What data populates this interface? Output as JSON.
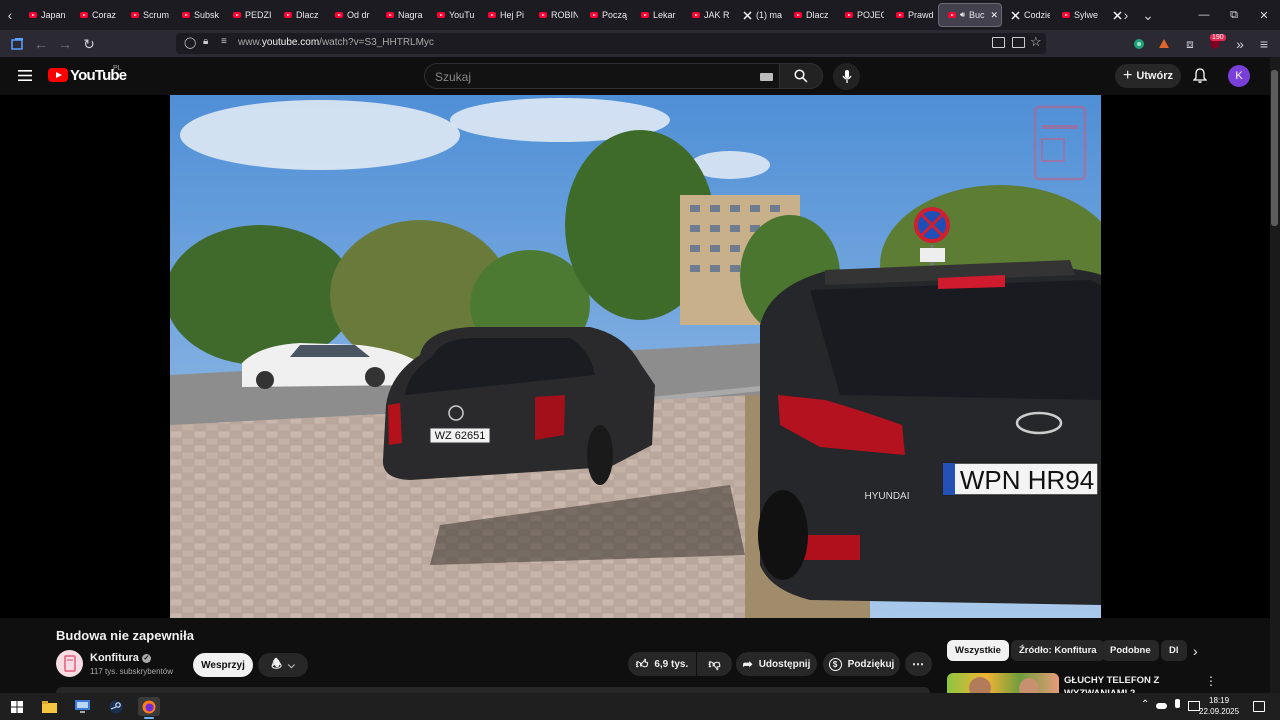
{
  "browser": {
    "tabs": [
      {
        "label": "Japan",
        "favicon": "youtube-icon"
      },
      {
        "label": "Coraz",
        "favicon": "youtube-icon"
      },
      {
        "label": "Scrum",
        "favicon": "youtube-icon"
      },
      {
        "label": "Subsk",
        "favicon": "youtube-icon"
      },
      {
        "label": "PEDZI",
        "favicon": "youtube-icon"
      },
      {
        "label": "Dlacz",
        "favicon": "youtube-icon"
      },
      {
        "label": "Od dr",
        "favicon": "youtube-icon"
      },
      {
        "label": "Nagra",
        "favicon": "youtube-icon"
      },
      {
        "label": "YouTu",
        "favicon": "youtube-icon"
      },
      {
        "label": "Hej Pi",
        "favicon": "youtube-icon"
      },
      {
        "label": "ROBIN",
        "favicon": "youtube-icon"
      },
      {
        "label": "Począ",
        "favicon": "youtube-icon"
      },
      {
        "label": "Lekar",
        "favicon": "youtube-icon"
      },
      {
        "label": "JAK R",
        "favicon": "youtube-icon"
      },
      {
        "label": "(1) ma",
        "favicon": "x-icon"
      },
      {
        "label": "Dlacz",
        "favicon": "youtube-icon"
      },
      {
        "label": "POJEC",
        "favicon": "youtube-icon"
      },
      {
        "label": "Prawd",
        "favicon": "youtube-icon"
      }
    ],
    "active_tab": {
      "label": "Buc",
      "favicon": "youtube-icon"
    },
    "after_tabs": [
      {
        "label": "Codzie",
        "favicon": "x-icon"
      },
      {
        "label": "Sylwe",
        "favicon": "youtube-icon"
      }
    ],
    "url_prefix": "www.",
    "url_domain": "youtube.com",
    "url_path": "/watch?v=S3_HHTRLMyc",
    "extension_badge": "190"
  },
  "youtube": {
    "logo_text": "YouTube",
    "country_code": "PL",
    "search_placeholder": "Szukaj",
    "create_label": "Utwórz",
    "avatar_letter": "K"
  },
  "video": {
    "title": "Budowa nie zapewniła",
    "channel_name": "Konfitura",
    "channel_subs": "117 tys. subskrybentów",
    "support_label": "Wesprzyj",
    "likes": "6,9 tys.",
    "share_label": "Udostępnij",
    "thanks_label": "Podziękuj",
    "plate_front": "WZ 62651",
    "plate_right": "WPN HR94",
    "car_brand": "HYUNDAI"
  },
  "chips": [
    "Wszystkie",
    "Źródło: Konfitura",
    "Podobne",
    "Dl"
  ],
  "recommendation": {
    "title_line1": "GŁUCHY TELEFON Z",
    "title_line2": "WYZWANIAMI 2"
  },
  "taskbar": {
    "time": "18:19",
    "date": "22.09.2025"
  }
}
